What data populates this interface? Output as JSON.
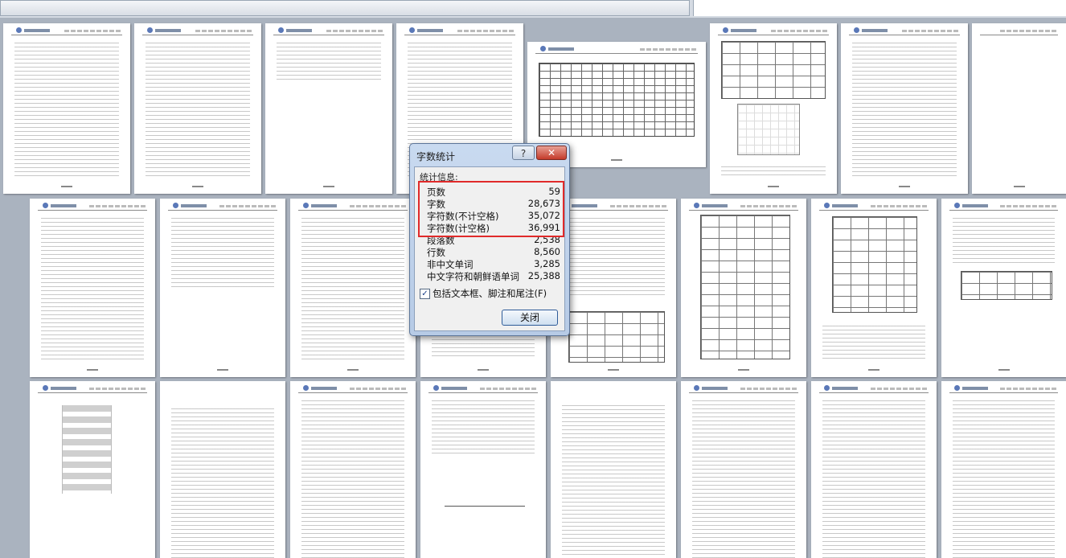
{
  "dialog": {
    "title": "字数统计",
    "help_label": "?",
    "close_glyph": "✕",
    "group_label": "统计信息:",
    "stats": [
      {
        "label": "页数",
        "value": "59"
      },
      {
        "label": "字数",
        "value": "28,673"
      },
      {
        "label": "字符数(不计空格)",
        "value": "35,072"
      },
      {
        "label": "字符数(计空格)",
        "value": "36,991"
      },
      {
        "label": "段落数",
        "value": "2,538"
      },
      {
        "label": "行数",
        "value": "8,560"
      },
      {
        "label": "非中文单词",
        "value": "3,285"
      },
      {
        "label": "中文字符和朝鲜语单词",
        "value": "25,388"
      }
    ],
    "checkbox_label": "包括文本框、脚注和尾注(F)",
    "checkbox_checked": true,
    "checkbox_glyph": "✓",
    "close_button_label": "关闭",
    "highlight_color": "#e02a2a"
  },
  "pages": {
    "count_visible_rows": 3,
    "background": "#aab3bf"
  }
}
